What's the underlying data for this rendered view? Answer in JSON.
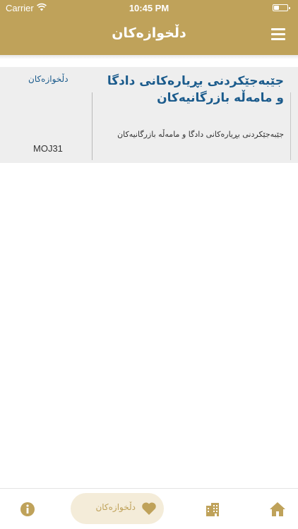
{
  "status_bar": {
    "carrier": "Carrier",
    "time": "10:45 PM"
  },
  "nav": {
    "title": "دڵخوازەکان"
  },
  "card": {
    "title": "جێبەجێکردنی بڕیارەکانی دادگا و مامەڵە بازرگانیەکان",
    "description": "جێبەجێکردنی بڕیارەکانی دادگا و مامەڵە بازرگانیەکان",
    "category": "دڵخوازەکان",
    "code": "MOJ31"
  },
  "tabbar": {
    "favorites_label": "دڵخوازەکان",
    "active_tab": "favorites"
  },
  "colors": {
    "brand_gold": "#bfa25a",
    "link_blue": "#1b5b8c",
    "card_bg": "#eeeeee",
    "active_tab_bg": "#f4ecd9"
  },
  "icons": [
    "wifi-icon",
    "battery-icon",
    "menu-icon",
    "info-icon",
    "heart-icon",
    "building-icon",
    "home-icon"
  ]
}
